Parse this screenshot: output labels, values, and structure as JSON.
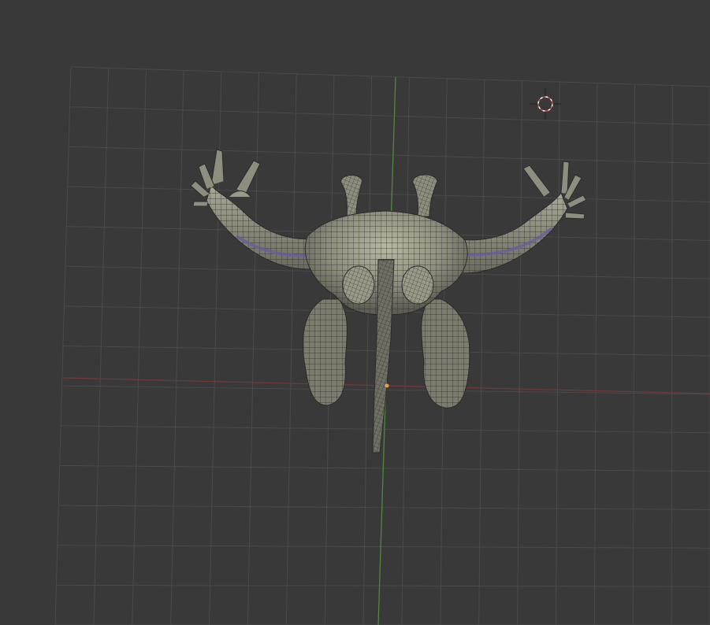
{
  "viewport": {
    "background": "#393939",
    "grid_line_color": "#4a4a4a",
    "y_axis_color": "#4f8a3c",
    "x_axis_color": "#7a3c3c",
    "cursor_color": "#c85050",
    "mesh_fill": "#8d8d7c",
    "mesh_wire": "#2b2b2b",
    "mesh_highlight": "#b5b59e",
    "seam_color": "#6a5e9a",
    "origin_color": "#f0a040"
  },
  "scene": {
    "object": "creature-mesh",
    "mode": "wireframe-on-shaded",
    "cursor_icon": "3d-cursor-icon",
    "origin_icon": "object-origin-icon"
  }
}
